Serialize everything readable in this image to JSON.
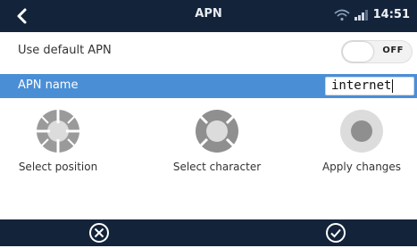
{
  "header": {
    "title": "APN",
    "time": "14:51"
  },
  "setting_default_apn": {
    "label": "Use default APN",
    "toggle_state": "OFF"
  },
  "setting_apn_name": {
    "label": "APN name",
    "value": "internet"
  },
  "controls": [
    {
      "caption": "Select position"
    },
    {
      "caption": "Select character"
    },
    {
      "caption": "Apply changes"
    }
  ],
  "icons": {
    "back": "back-arrow-icon",
    "wifi": "wifi-icon",
    "signal": "signal-strength-icon",
    "cancel": "cancel-circle-icon",
    "confirm": "confirm-check-icon"
  },
  "colors": {
    "header_bg": "#13233a",
    "highlight": "#4a8ed6",
    "control_gray": "#9a9a9a"
  }
}
